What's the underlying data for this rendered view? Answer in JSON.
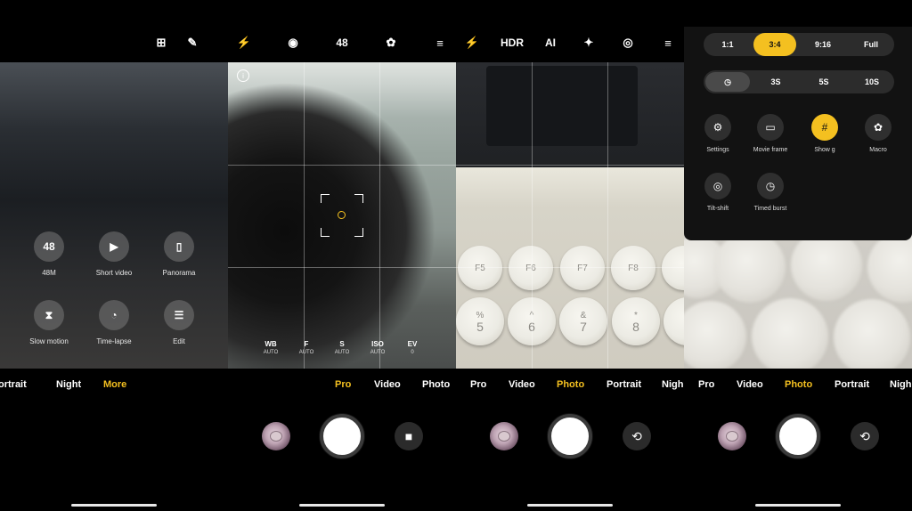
{
  "panel1": {
    "top_icons": [
      {
        "name": "grid-icon",
        "glyph": "⊞"
      },
      {
        "name": "edit-icon",
        "glyph": "✎"
      }
    ],
    "grid": [
      {
        "label": "48M",
        "glyph": "48"
      },
      {
        "label": "Short video",
        "glyph": "▶"
      },
      {
        "label": "Panorama",
        "glyph": "▯"
      },
      {
        "label": "Slow motion",
        "glyph": "⧗"
      },
      {
        "label": "Time-lapse",
        "glyph": "◔"
      },
      {
        "label": "Edit",
        "glyph": "☰"
      }
    ],
    "modes": [
      "ortrait",
      "Night",
      "More"
    ],
    "active_mode": "More"
  },
  "panel2": {
    "top_icons": [
      "⚡",
      "◉",
      "48",
      "✿",
      "≡"
    ],
    "info": "i",
    "params": [
      {
        "name": "WB",
        "value": "AUTO"
      },
      {
        "name": "F",
        "value": "AUTO"
      },
      {
        "name": "S",
        "value": "AUTO"
      },
      {
        "name": "ISO",
        "value": "AUTO"
      },
      {
        "name": "EV",
        "value": "0"
      }
    ],
    "modes": [
      "Pro",
      "Video",
      "Photo"
    ],
    "active_mode": "Pro"
  },
  "panel3": {
    "top_icons": [
      "⚡",
      "HDR",
      "AI",
      "✦",
      "◎",
      "≡"
    ],
    "keys_row1": [
      "F5",
      "F6",
      "F7",
      "F8"
    ],
    "keys_row2": [
      [
        "%",
        "5"
      ],
      [
        "^",
        "6"
      ],
      [
        "&",
        "7"
      ],
      [
        "*",
        "8"
      ]
    ],
    "modes": [
      "Pro",
      "Video",
      "Photo",
      "Portrait",
      "Nigh"
    ],
    "active_mode": "Photo"
  },
  "panel4": {
    "ratios": [
      "1:1",
      "3:4",
      "9:16",
      "Full"
    ],
    "selected_ratio": "3:4",
    "timers": [
      "◷",
      "3S",
      "5S",
      "10S"
    ],
    "menu_items": [
      {
        "label": "Settings",
        "glyph": "⚙",
        "on": false
      },
      {
        "label": "Movie frame",
        "glyph": "▭",
        "on": false
      },
      {
        "label": "Show g",
        "glyph": "#",
        "on": true
      },
      {
        "label": "Macro",
        "glyph": "✿",
        "on": false
      },
      {
        "label": "Tilt-shift",
        "glyph": "◎",
        "on": false
      },
      {
        "label": "Timed burst",
        "glyph": "◷",
        "on": false
      }
    ],
    "modes": [
      "Pro",
      "Video",
      "Photo",
      "Portrait",
      "Nigh"
    ],
    "active_mode": "Photo"
  },
  "video_button": "■",
  "flip_button": "⟲",
  "colors": {
    "accent": "#f4c020",
    "bg": "#000000"
  }
}
